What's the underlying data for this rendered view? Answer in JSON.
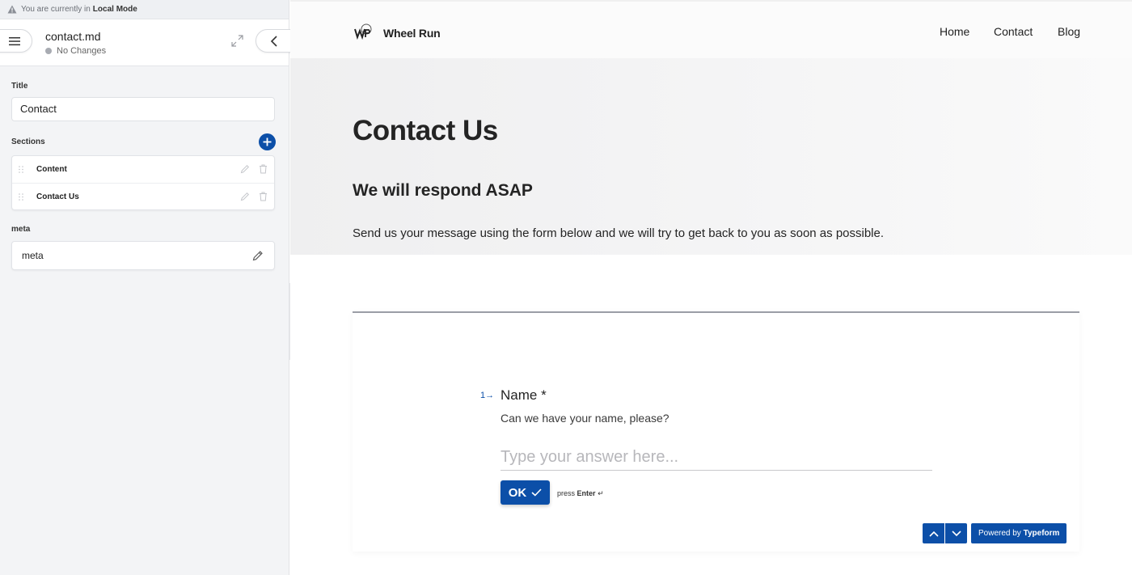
{
  "mode_bar": {
    "prefix": "You are currently in",
    "mode": "Local Mode"
  },
  "file": {
    "name": "contact.md",
    "status": "No Changes"
  },
  "form_fields": {
    "title_label": "Title",
    "title_value": "Contact",
    "sections_label": "Sections",
    "sections": [
      {
        "label": "Content"
      },
      {
        "label": "Contact Us"
      }
    ],
    "meta_label": "meta",
    "meta_value": "meta"
  },
  "site": {
    "brand": "Wheel Run",
    "nav": [
      {
        "label": "Home"
      },
      {
        "label": "Contact"
      },
      {
        "label": "Blog"
      }
    ],
    "active_nav": "Contact",
    "hero": {
      "title": "Contact Us",
      "subtitle": "We will respond ASAP",
      "text": "Send us your message using the form below and we will try to get back to you as soon as possible."
    }
  },
  "typeform": {
    "question_number": "1",
    "question_title": "Name *",
    "question_description": "Can we have your name, please?",
    "input_placeholder": "Type your answer here...",
    "ok_label": "OK",
    "press_prefix": "press",
    "press_key": "Enter",
    "powered_prefix": "Powered by",
    "powered_brand": "Typeform"
  },
  "colors": {
    "accent": "#0c4fa8",
    "sidebar_bg": "#f3f4f6"
  }
}
